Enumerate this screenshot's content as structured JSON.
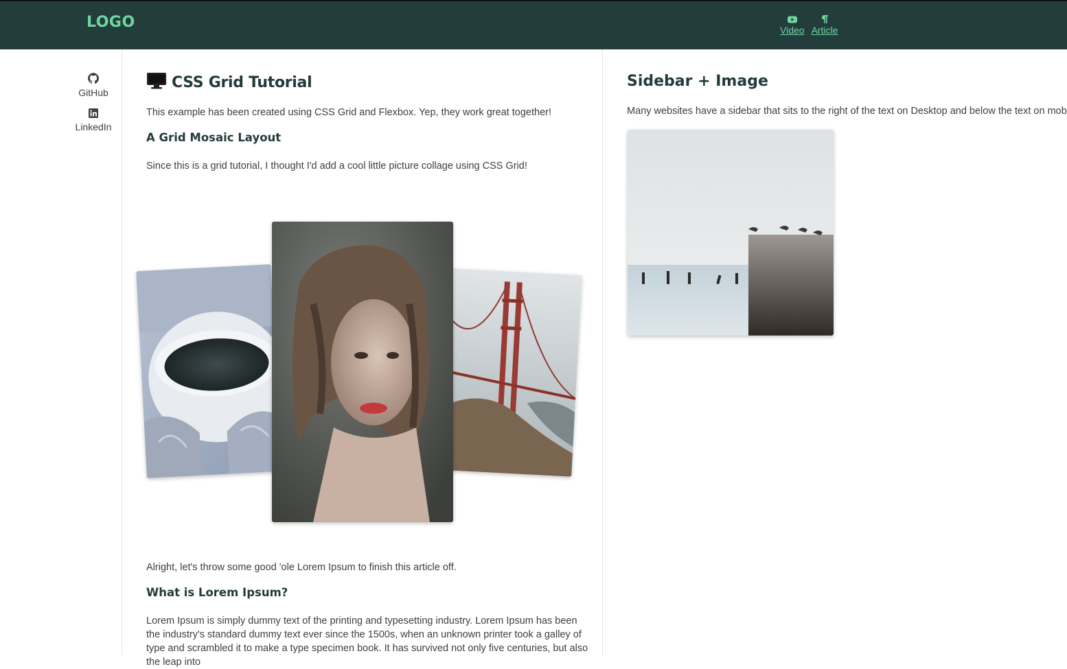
{
  "header": {
    "logo": "LOGO",
    "nav": [
      {
        "label": "Video",
        "icon": "youtube-icon"
      },
      {
        "label": "Article",
        "icon": "pilcrow-icon"
      }
    ]
  },
  "rail": {
    "items": [
      {
        "label": "GitHub",
        "icon": "github-icon"
      },
      {
        "label": "LinkedIn",
        "icon": "linkedin-icon"
      }
    ]
  },
  "main": {
    "title": "CSS Grid Tutorial",
    "title_icon": "monitor-icon",
    "intro": "This example has been created using CSS Grid and Flexbox. Yep, they work great together!",
    "mosaic_heading": "A Grid Mosaic Layout",
    "mosaic_text": "Since this is a grid tutorial, I thought I'd add a cool little picture collage using CSS Grid!",
    "photos": [
      {
        "name": "coffee-cup-photo"
      },
      {
        "name": "woman-portrait-photo"
      },
      {
        "name": "golden-gate-bridge-photo"
      }
    ],
    "outro": "Alright, let's throw some good 'ole Lorem Ipsum to finish this article off.",
    "lorem_heading": "What is Lorem Ipsum?",
    "lorem_text": "Lorem Ipsum is simply dummy text of the printing and typesetting industry. Lorem Ipsum has been the industry's standard dummy text ever since the 1500s, when an unknown printer took a galley of type and scrambled it to make a type specimen book. It has survived not only five centuries, but also the leap into"
  },
  "sidebar": {
    "title": "Sidebar + Image",
    "text": "Many websites have a sidebar that sits to the right of the text on Desktop and below the text on mobile.",
    "photo": "seagulls-pier-photo"
  },
  "colors": {
    "header_bg": "#233d3d",
    "accent": "#6fd6a0",
    "heading": "#243a3a",
    "text": "#3a3f44"
  }
}
